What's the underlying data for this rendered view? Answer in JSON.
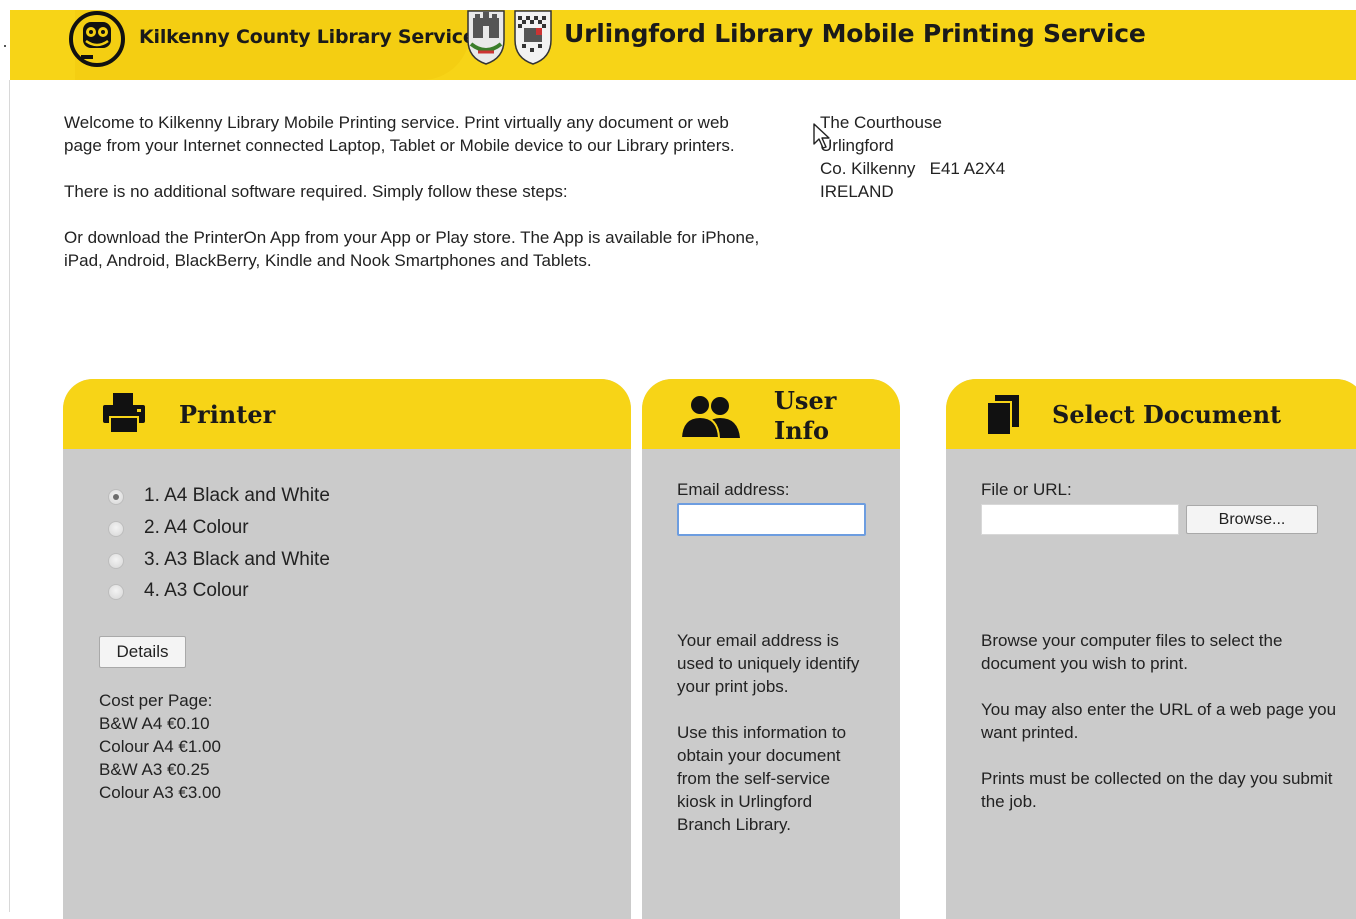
{
  "header": {
    "org_name": "Kilkenny County Library Service",
    "site_title": "Urlingford Library Mobile Printing Service",
    "accent_color": "#f7d417"
  },
  "intro": {
    "p1": "Welcome to Kilkenny Library Mobile Printing service. Print virtually any document or web page from your Internet connected Laptop, Tablet or Mobile device to our Library printers.",
    "p2": "There is no additional software required. Simply follow these steps:",
    "p3": "Or download the PrinterOn App from your App or Play store. The App is available for iPhone, iPad, Android, BlackBerry, Kindle and Nook Smartphones and Tablets."
  },
  "address": {
    "line1": "The Courthouse",
    "line2": "Urlingford",
    "line3": "Co. Kilkenny   E41 A2X4",
    "line4": "IRELAND"
  },
  "printer": {
    "title": "Printer",
    "icon": "printer-icon",
    "options": [
      {
        "label": "1. A4 Black and White",
        "selected": true
      },
      {
        "label": "2. A4 Colour",
        "selected": false
      },
      {
        "label": "3. A3 Black and White",
        "selected": false
      },
      {
        "label": "4. A3 Colour",
        "selected": false
      }
    ],
    "details_label": "Details",
    "cost_heading": "Cost per Page:",
    "costs": [
      "B&W A4 €0.10",
      "Colour A4 €1.00",
      "B&W A3 €0.25",
      "Colour A3 €3.00"
    ]
  },
  "user_info": {
    "title_line1": "User",
    "title_line2": "Info",
    "icon": "users-icon",
    "email_label": "Email address:",
    "email_value": "",
    "help1": "Your email address is used to uniquely identify your print jobs.",
    "help2": "Use this information to obtain your document from the self-service kiosk in Urlingford Branch Library."
  },
  "document": {
    "title": "Select Document",
    "icon": "document-icon",
    "file_label": "File or URL:",
    "file_value": "",
    "browse_label": "Browse...",
    "help1": "Browse your computer files to select the document you wish to print.",
    "help2": "You may also enter the URL of a web page you want printed.",
    "help3": "Prints must be collected on the day you submit the job."
  }
}
